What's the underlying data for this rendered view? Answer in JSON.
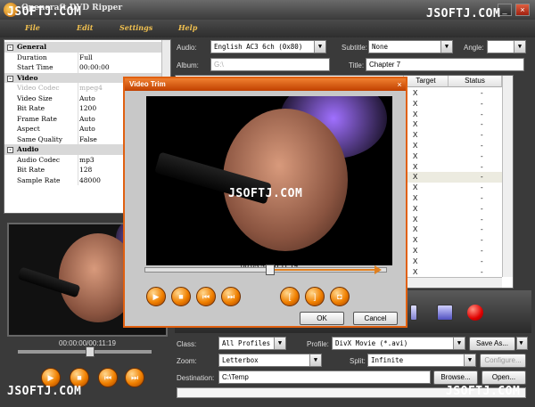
{
  "app": {
    "title": "Opencraft DVD Ripper"
  },
  "watermarks": {
    "top_right": "JSOFTJ.COM",
    "top_left": "JSOFTJ.COM",
    "center": "JSOFTJ.COM",
    "bottom_left": "JSOFTJ.COM",
    "bottom_right": "JSOFTJ.COM"
  },
  "window_controls": {
    "minimize": "_",
    "close": "×"
  },
  "menu": [
    "File",
    "Edit",
    "Settings",
    "Help"
  ],
  "properties": {
    "rows": [
      {
        "type": "group",
        "key": "General",
        "value": ""
      },
      {
        "type": "item",
        "key": "Duration",
        "value": "Full"
      },
      {
        "type": "item",
        "key": "Start Time",
        "value": "00:00:00"
      },
      {
        "type": "group",
        "key": "Video",
        "value": ""
      },
      {
        "type": "disabled",
        "key": "Video Codec",
        "value": "mpeg4"
      },
      {
        "type": "item",
        "key": "Video Size",
        "value": "Auto"
      },
      {
        "type": "item",
        "key": "Bit Rate",
        "value": "1200"
      },
      {
        "type": "item",
        "key": "Frame Rate",
        "value": "Auto"
      },
      {
        "type": "item",
        "key": "Aspect",
        "value": "Auto"
      },
      {
        "type": "item",
        "key": "Same Quality",
        "value": "False"
      },
      {
        "type": "group",
        "key": "Audio",
        "value": ""
      },
      {
        "type": "item",
        "key": "Audio Codec",
        "value": "mp3"
      },
      {
        "type": "item",
        "key": "Bit Rate",
        "value": "128"
      },
      {
        "type": "item",
        "key": "Sample Rate",
        "value": "48000"
      }
    ],
    "group_toggle": "-"
  },
  "preview": {
    "time": "00:00:00/00:11:19",
    "progress": 0.0
  },
  "preview_buttons": [
    "play",
    "stop",
    "prev",
    "next"
  ],
  "audio": {
    "label": "Audio:",
    "value": "English AC3 6ch (0x80)"
  },
  "subtitle": {
    "label": "Subtitle:",
    "value": "None"
  },
  "angle": {
    "label": "Angle:",
    "value": ""
  },
  "album": {
    "label": "Album:",
    "value": "G:\\"
  },
  "title_field": {
    "label": "Title:",
    "value": "Chapter 7"
  },
  "tracks": {
    "headers": {
      "target": "Target",
      "status": "Status"
    },
    "rows": [
      {
        "target": "X",
        "status": "-",
        "selected": false
      },
      {
        "target": "X",
        "status": "-",
        "selected": false
      },
      {
        "target": "X",
        "status": "-",
        "selected": false
      },
      {
        "target": "X",
        "status": "-",
        "selected": false
      },
      {
        "target": "X",
        "status": "-",
        "selected": false
      },
      {
        "target": "X",
        "status": "-",
        "selected": false
      },
      {
        "target": "X",
        "status": "-",
        "selected": false
      },
      {
        "target": "X",
        "status": "-",
        "selected": false
      },
      {
        "target": "X",
        "status": "-",
        "selected": true
      },
      {
        "target": "X",
        "status": "-",
        "selected": false
      },
      {
        "target": "X",
        "status": "-",
        "selected": false
      },
      {
        "target": "X",
        "status": "-",
        "selected": false
      },
      {
        "target": "X",
        "status": "-",
        "selected": false
      },
      {
        "target": "X",
        "status": "-",
        "selected": false
      },
      {
        "target": "X",
        "status": "-",
        "selected": false
      },
      {
        "target": "X",
        "status": "-",
        "selected": false
      },
      {
        "target": "X",
        "status": "-",
        "selected": false
      },
      {
        "target": "X",
        "status": "-",
        "selected": false
      }
    ]
  },
  "class": {
    "label": "Class:",
    "value": "All Profiles"
  },
  "profile": {
    "label": "Profile:",
    "value": "DivX Movie  (*.avi)",
    "save_as": "Save As..."
  },
  "zoom": {
    "label": "Zoom:",
    "value": "Letterbox"
  },
  "split": {
    "label": "Split:",
    "value": "Infinite",
    "configure": "Configure..."
  },
  "destination": {
    "label": "Destination:",
    "value": "C:\\Temp",
    "browse": "Browse...",
    "open": "Open..."
  },
  "dialog": {
    "title": "Video Trim",
    "close": "×",
    "time": "00:05:52/00:11:19",
    "progress": 0.52,
    "buttons": [
      "play",
      "stop",
      "prev",
      "next"
    ],
    "trim_buttons": [
      "set-start",
      "set-end",
      "clear"
    ],
    "ok": "OK",
    "cancel": "Cancel"
  },
  "glyphs": {
    "dropdown": "▼",
    "play": "▶",
    "stop": "■",
    "prev": "⏮",
    "next": "⏭",
    "mark_start": "[",
    "mark_end": "]",
    "clear": "◘"
  },
  "colors": {
    "accent": "#f08000",
    "dialog_border": "#e06010",
    "background": "#3a3a3a"
  }
}
